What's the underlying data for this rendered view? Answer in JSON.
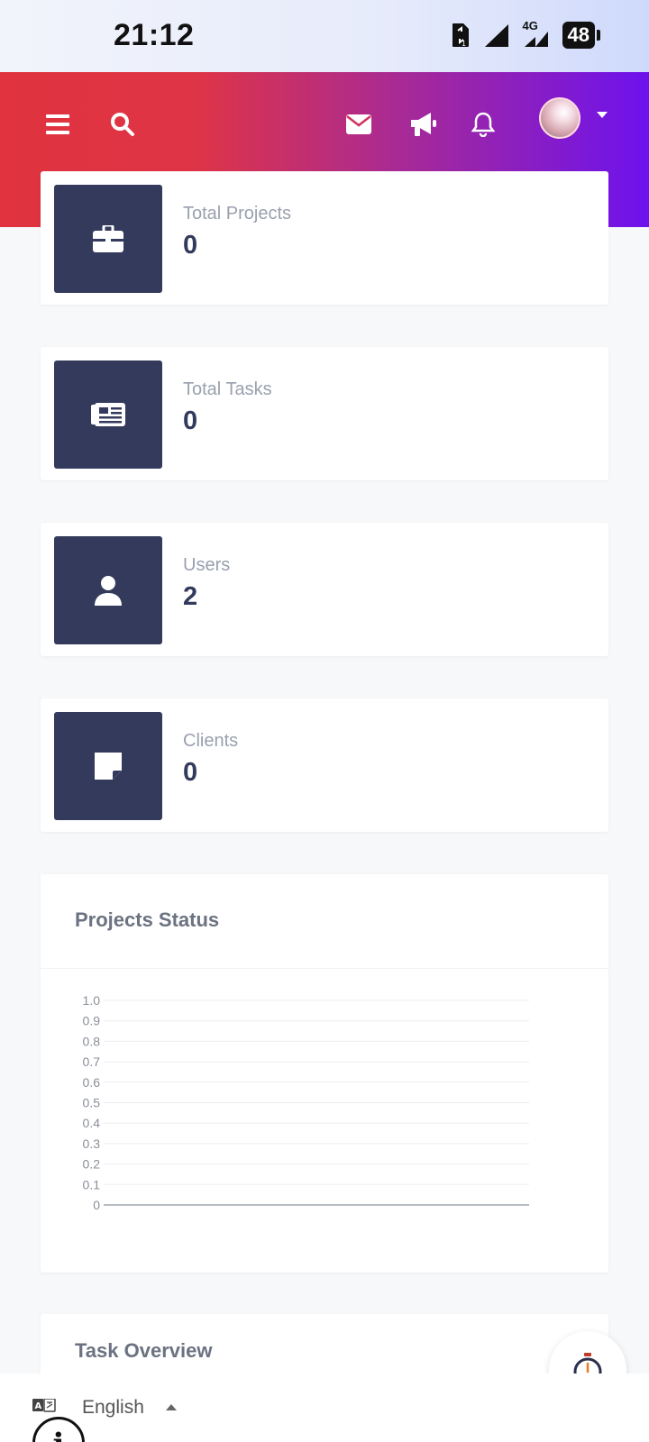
{
  "status_bar": {
    "time": "21:12",
    "network": "4G",
    "battery": "48"
  },
  "header": {
    "icons": [
      "menu-icon",
      "search-icon",
      "mail-icon",
      "megaphone-icon",
      "bell-icon",
      "avatar",
      "chevron-down-icon"
    ]
  },
  "stats": [
    {
      "label": "Total Projects",
      "value": "0",
      "icon": "briefcase-icon"
    },
    {
      "label": "Total Tasks",
      "value": "0",
      "icon": "newspaper-icon"
    },
    {
      "label": "Users",
      "value": "2",
      "icon": "user-icon"
    },
    {
      "label": "Clients",
      "value": "0",
      "icon": "sticky-note-icon"
    }
  ],
  "projects_status": {
    "title": "Projects Status"
  },
  "chart_data": {
    "type": "bar",
    "title": "",
    "categories": [],
    "values": [],
    "yticks": [
      "1.0",
      "0.9",
      "0.8",
      "0.7",
      "0.6",
      "0.5",
      "0.4",
      "0.3",
      "0.2",
      "0.1",
      "0"
    ],
    "ylim": [
      0,
      1
    ],
    "grid": true
  },
  "task_overview": {
    "title": "Task Overview"
  },
  "language": {
    "label": "English"
  },
  "colors": {
    "header_start": "#e0333f",
    "header_end": "#6d12ee",
    "tile": "#343a5c"
  }
}
